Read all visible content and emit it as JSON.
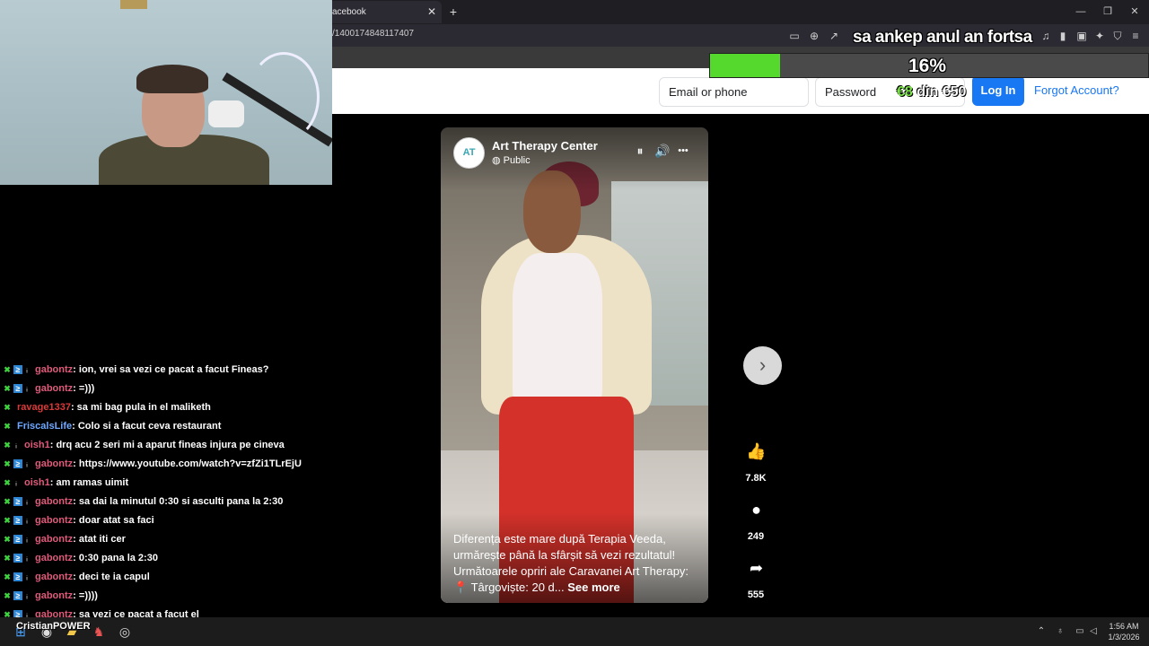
{
  "browser": {
    "tab_title": "acebook",
    "tab_close": "✕",
    "new_tab": "+",
    "url": "/1400174848117407",
    "win_min": "—",
    "win_restore": "❐",
    "win_close": "✕"
  },
  "facebook": {
    "email_placeholder": "Email or phone",
    "password_placeholder": "Password",
    "login_label": "Log In",
    "forgot_label": "Forgot Account?"
  },
  "overlay": {
    "headline": "sa ankep anul an fortsa",
    "progress_percent": 16,
    "progress_label": "16%",
    "goal_current": "€8",
    "goal_text": " din €50",
    "progress_color": "#55d92c"
  },
  "video": {
    "avatar": "AT",
    "page_name": "Art Therapy Center",
    "visibility": "Public",
    "pause_icon": "⏸",
    "volume_icon": "🔊",
    "more_icon": "•••",
    "caption": "Diferența este mare după Terapia Veeda, urmărește până la sfârșit să vezi rezultatul! Următoarele opriri ale Caravanei Art Therapy: 📍 Târgoviște: 20 d...",
    "see_more": " See more",
    "likes": "7.8K",
    "comments": "249",
    "shares": "555",
    "next_icon": "›"
  },
  "chat": [
    {
      "user": "gabontz",
      "color": "#e05a7a",
      "text": ": ion, vrei sa vezi ce pacat a facut Fineas?",
      "badges": [
        "b1",
        "b2",
        "b3"
      ]
    },
    {
      "user": "gabontz",
      "color": "#e05a7a",
      "text": ": =)))",
      "badges": [
        "b1",
        "b2",
        "b3"
      ]
    },
    {
      "user": "ravage1337",
      "color": "#d83a3a",
      "text": ": sa mi bag pula in el maliketh",
      "badges": [
        "b1"
      ]
    },
    {
      "user": "FriscalsLife",
      "color": "#6fa8ff",
      "text": ": Colo si a facut ceva restaurant",
      "badges": [
        "b1"
      ]
    },
    {
      "user": "oish1",
      "color": "#e05a7a",
      "text": ": drq acu 2 seri mi a aparut fineas injura pe cineva",
      "badges": [
        "b1",
        "b3"
      ]
    },
    {
      "user": "gabontz",
      "color": "#e05a7a",
      "text": ": https://www.youtube.com/watch?v=zfZi1TLrEjU",
      "badges": [
        "b1",
        "b2",
        "b3"
      ]
    },
    {
      "user": "oish1",
      "color": "#e05a7a",
      "text": ": am ramas uimit",
      "badges": [
        "b1",
        "b3"
      ]
    },
    {
      "user": "gabontz",
      "color": "#e05a7a",
      "text": ": sa dai la minutul 0:30 si asculti pana la 2:30",
      "badges": [
        "b1",
        "b2",
        "b3"
      ]
    },
    {
      "user": "gabontz",
      "color": "#e05a7a",
      "text": ": doar atat sa faci",
      "badges": [
        "b1",
        "b2",
        "b3"
      ]
    },
    {
      "user": "gabontz",
      "color": "#e05a7a",
      "text": ": atat iti cer",
      "badges": [
        "b1",
        "b2",
        "b3"
      ]
    },
    {
      "user": "gabontz",
      "color": "#e05a7a",
      "text": ": 0:30 pana la 2:30",
      "badges": [
        "b1",
        "b2",
        "b3"
      ]
    },
    {
      "user": "gabontz",
      "color": "#e05a7a",
      "text": ": deci te ia capul",
      "badges": [
        "b1",
        "b2",
        "b3"
      ]
    },
    {
      "user": "gabontz",
      "color": "#e05a7a",
      "text": ": =))))",
      "badges": [
        "b1",
        "b2",
        "b3"
      ]
    },
    {
      "user": "gabontz",
      "color": "#e05a7a",
      "text": ": sa vezi ce pacat a facut el",
      "badges": [
        "b1",
        "b2",
        "b3"
      ]
    }
  ],
  "taskbar": {
    "streamer": "CristianPOWER",
    "time": "1:56 AM",
    "date": "1/3/2026"
  }
}
